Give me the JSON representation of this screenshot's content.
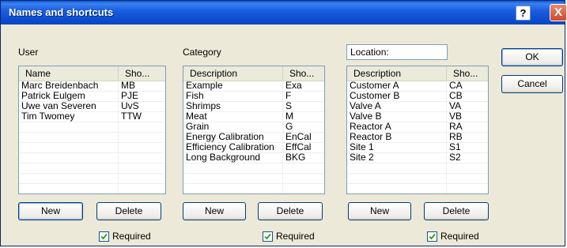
{
  "window": {
    "title": "Names and shortcuts",
    "help_label": "?",
    "close_label": "X"
  },
  "user": {
    "label": "User",
    "columns": [
      "Name",
      "Sho..."
    ],
    "rows": [
      [
        "Marc Breidenbach",
        "MB"
      ],
      [
        "Patrick Eulgem",
        "PJE"
      ],
      [
        "Uwe van Severen",
        "UvS"
      ],
      [
        "Tim Twomey",
        "TTW"
      ]
    ],
    "new_label": "New",
    "delete_label": "Delete",
    "required_label": "Required",
    "required_checked": true
  },
  "category": {
    "label": "Category",
    "columns": [
      "Description",
      "Sho..."
    ],
    "rows": [
      [
        "Example",
        "Exa"
      ],
      [
        "Fish",
        "F"
      ],
      [
        "Shrimps",
        "S"
      ],
      [
        "Meat",
        "M"
      ],
      [
        "Grain",
        "G"
      ],
      [
        "Energy Calibration",
        "EnCal"
      ],
      [
        "Efficiency Calibration",
        "EffCal"
      ],
      [
        "Long Background",
        "BKG"
      ]
    ],
    "new_label": "New",
    "delete_label": "Delete",
    "required_label": "Required",
    "required_checked": true
  },
  "location": {
    "field_value": "Location:",
    "columns": [
      "Description",
      "Sho..."
    ],
    "rows": [
      [
        "Customer A",
        "CA"
      ],
      [
        "Customer B",
        "CB"
      ],
      [
        "Valve A",
        "VA"
      ],
      [
        "Valve B",
        "VB"
      ],
      [
        "Reactor A",
        "RA"
      ],
      [
        "Reactor B",
        "RB"
      ],
      [
        "Site 1",
        "S1"
      ],
      [
        "Site 2",
        "S2"
      ]
    ],
    "new_label": "New",
    "delete_label": "Delete",
    "required_label": "Required",
    "required_checked": true
  },
  "actions": {
    "ok_label": "OK",
    "cancel_label": "Cancel"
  },
  "colors": {
    "titlebar": "#0d4fd0",
    "dialog_bg": "#ece9d8",
    "list_border": "#7f9db9"
  }
}
